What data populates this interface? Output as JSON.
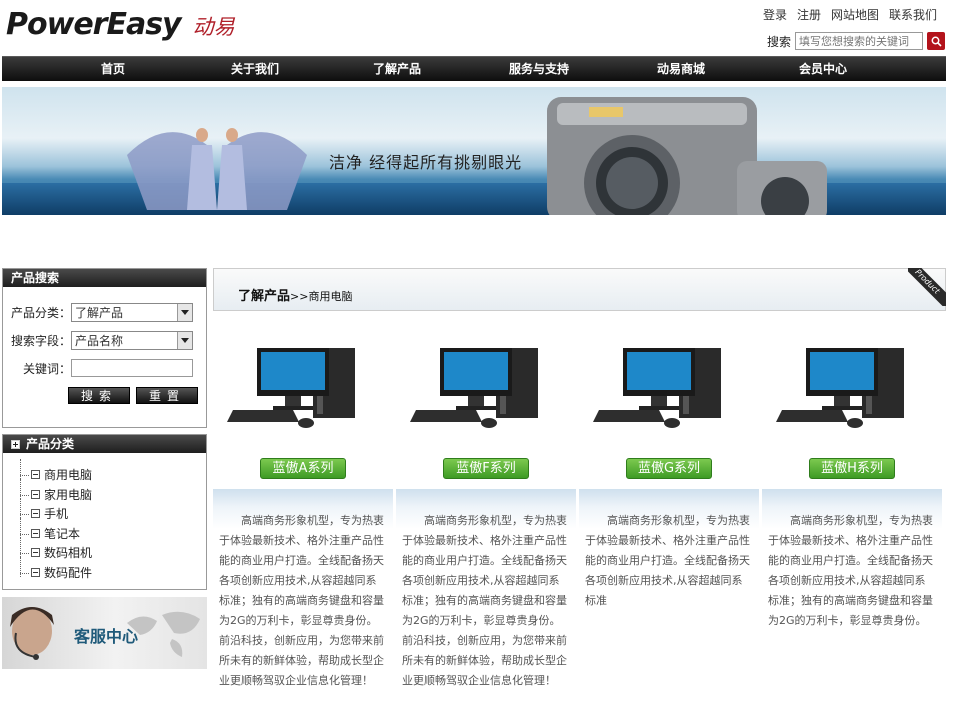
{
  "header": {
    "logo_en": "PowerEasy",
    "logo_cn": "动易",
    "top_links": [
      "登录",
      "注册",
      "网站地图",
      "联系我们"
    ],
    "search_label": "搜索",
    "search_placeholder": "填写您想搜索的关键词"
  },
  "nav": {
    "items": [
      "首页",
      "关于我们",
      "了解产品",
      "服务与支持",
      "动易商城",
      "会员中心"
    ]
  },
  "banner": {
    "slogan": "洁净 经得起所有挑剔眼光"
  },
  "search_panel": {
    "title": "产品搜索",
    "category_label": "产品分类：",
    "category_value": "了解产品",
    "field_label": "搜索字段：",
    "field_value": "产品名称",
    "keyword_label": "关键词：",
    "search_btn": "搜索",
    "reset_btn": "重置"
  },
  "category_panel": {
    "title": "产品分类",
    "items": [
      "商用电脑",
      "家用电脑",
      "手机",
      "笔记本",
      "数码相机",
      "数码配件"
    ]
  },
  "service": {
    "label": "客服中心"
  },
  "content": {
    "title": "了解产品",
    "breadcrumb": ">>商用电脑",
    "corner_label": "Product",
    "products": [
      {
        "name": "蓝傲A系列",
        "desc": "高端商务形象机型，专为热衷于体验最新技术、格外注重产品性能的商业用户打造。全线配备扬天各项创新应用技术,从容超越同系标准；独有的高端商务键盘和容量为2G的万利卡，彰显尊贵身份。前沿科技，创新应用，为您带来前所未有的新鲜体验，帮助成长型企业更顺畅驾驭企业信息化管理！"
      },
      {
        "name": "蓝傲F系列",
        "desc": "高端商务形象机型，专为热衷于体验最新技术、格外注重产品性能的商业用户打造。全线配备扬天各项创新应用技术,从容超越同系标准；独有的高端商务键盘和容量为2G的万利卡，彰显尊贵身份。前沿科技，创新应用，为您带来前所未有的新鲜体验，帮助成长型企业更顺畅驾驭企业信息化管理！"
      },
      {
        "name": "蓝傲G系列",
        "desc": "高端商务形象机型，专为热衷于体验最新技术、格外注重产品性能的商业用户打造。全线配备扬天各项创新应用技术,从容超越同系标准"
      },
      {
        "name": "蓝傲H系列",
        "desc": "高端商务形象机型，专为热衷于体验最新技术、格外注重产品性能的商业用户打造。全线配备扬天各项创新应用技术,从容超越同系标准；独有的高端商务键盘和容量为2G的万利卡，彰显尊贵身份。"
      }
    ]
  }
}
